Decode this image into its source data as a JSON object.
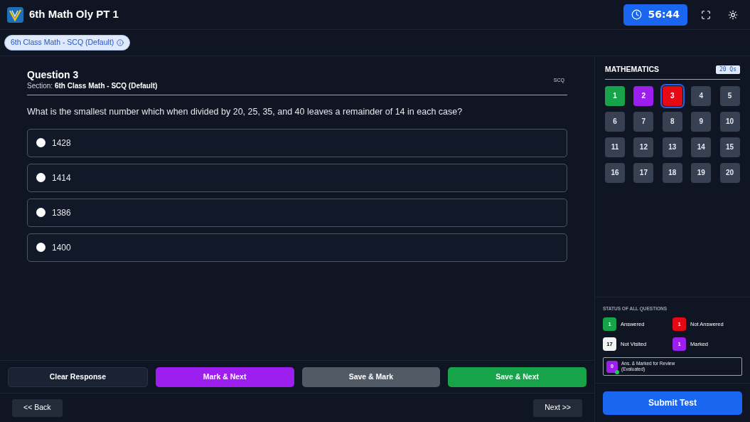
{
  "header": {
    "title": "6th Math Oly PT 1",
    "timer": "56:44"
  },
  "section_chip": {
    "label": "6th Class Math - SCQ (Default)"
  },
  "question": {
    "title": "Question 3",
    "section_label": "Section:",
    "section_name": "6th Class Math - SCQ (Default)",
    "type": "SCQ",
    "text": "What is the smallest number which when divided by 20, 25, 35, and 40 leaves a remainder of 14 in each case?",
    "options": [
      {
        "label": "1428",
        "selected": false
      },
      {
        "label": "1414",
        "selected": false
      },
      {
        "label": "1386",
        "selected": false
      },
      {
        "label": "1400",
        "selected": false
      }
    ]
  },
  "actions": [
    {
      "label": "Clear Response",
      "kind": "plain"
    },
    {
      "label": "Mark & Next",
      "kind": "marked"
    },
    {
      "label": "Save & Mark",
      "kind": "grey"
    },
    {
      "label": "Save & Next",
      "kind": "answered"
    }
  ],
  "nav": {
    "back": "<< Back",
    "next": "Next >>"
  },
  "palette": {
    "subject": "MATHEMATICS",
    "count": "20 Qs",
    "questions": [
      {
        "label": "1",
        "kind": "answered",
        "selected": false
      },
      {
        "label": "2",
        "kind": "marked",
        "selected": false
      },
      {
        "label": "3",
        "kind": "not_answered",
        "selected": true
      },
      {
        "label": "4",
        "kind": "not_visited",
        "selected": false
      },
      {
        "label": "5",
        "kind": "not_visited",
        "selected": false
      },
      {
        "label": "6",
        "kind": "not_visited",
        "selected": false
      },
      {
        "label": "7",
        "kind": "not_visited",
        "selected": false
      },
      {
        "label": "8",
        "kind": "not_visited",
        "selected": false
      },
      {
        "label": "9",
        "kind": "not_visited",
        "selected": false
      },
      {
        "label": "10",
        "kind": "not_visited",
        "selected": false
      },
      {
        "label": "11",
        "kind": "not_visited",
        "selected": false
      },
      {
        "label": "12",
        "kind": "not_visited",
        "selected": false
      },
      {
        "label": "13",
        "kind": "not_visited",
        "selected": false
      },
      {
        "label": "14",
        "kind": "not_visited",
        "selected": false
      },
      {
        "label": "15",
        "kind": "not_visited",
        "selected": false
      },
      {
        "label": "16",
        "kind": "not_visited",
        "selected": false
      },
      {
        "label": "17",
        "kind": "not_visited",
        "selected": false
      },
      {
        "label": "18",
        "kind": "not_visited",
        "selected": false
      },
      {
        "label": "19",
        "kind": "not_visited",
        "selected": false
      },
      {
        "label": "20",
        "kind": "not_visited",
        "selected": false
      }
    ]
  },
  "status": {
    "title": "STATUS OF ALL QUESTIONS",
    "items": [
      {
        "count": "1",
        "label": "Answered",
        "color": "#16a34a"
      },
      {
        "count": "1",
        "label": "Not Answered",
        "color": "#e50914"
      },
      {
        "count": "17",
        "label": "Not Visited",
        "color": "#f3f4f6"
      },
      {
        "count": "1",
        "label": "Marked",
        "color": "#9d1ff0"
      }
    ],
    "review": {
      "count": "0",
      "label": "Ans. & Marked for Review",
      "sub": "(Evaluated)",
      "color": "#9d1ff0"
    }
  },
  "submit": "Submit Test"
}
